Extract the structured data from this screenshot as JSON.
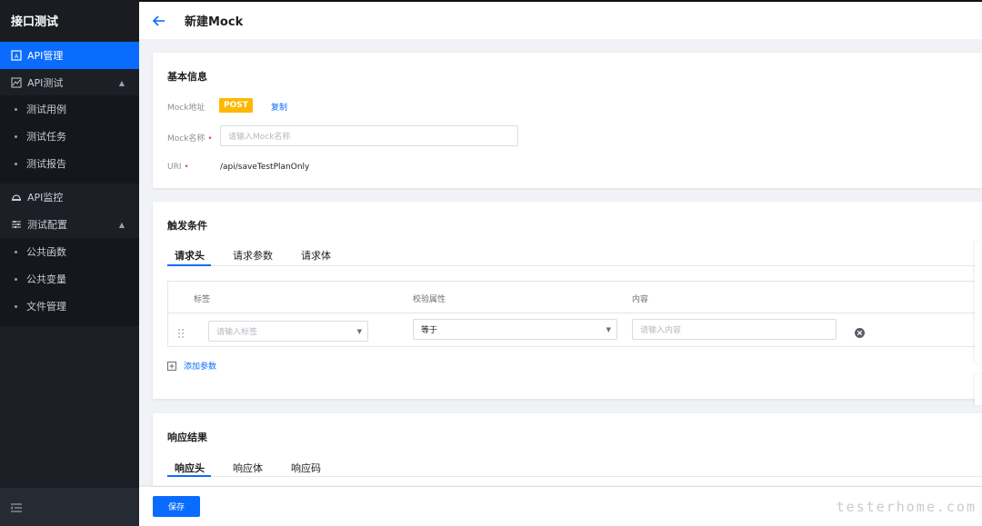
{
  "sidebar": {
    "title": "接口测试",
    "items": [
      {
        "label": "API管理",
        "icon": "api-icon",
        "active": true
      },
      {
        "label": "API测试",
        "icon": "chart-icon"
      },
      {
        "label": "测试用例"
      },
      {
        "label": "测试任务"
      },
      {
        "label": "测试报告"
      },
      {
        "label": "API监控",
        "icon": "monitor-icon"
      },
      {
        "label": "测试配置",
        "icon": "sliders-icon"
      },
      {
        "label": "公共函数"
      },
      {
        "label": "公共变量"
      },
      {
        "label": "文件管理"
      }
    ]
  },
  "header": {
    "title": "新建Mock"
  },
  "basic": {
    "title": "基本信息",
    "mock_address_label": "Mock地址",
    "method": "POST",
    "copy_label": "复制",
    "mock_name_label": "Mock名称",
    "mock_name_placeholder": "请输入Mock名称",
    "uri_label": "URI",
    "uri_value": "/api/saveTestPlanOnly"
  },
  "trigger": {
    "title": "触发条件",
    "tabs": [
      "请求头",
      "请求参数",
      "请求体"
    ],
    "columns": [
      "标签",
      "校验属性",
      "内容"
    ],
    "row": {
      "tag_placeholder": "请输入标签",
      "attr_value": "等于",
      "content_placeholder": "请输入内容"
    },
    "add_param_label": "添加参数"
  },
  "response": {
    "title": "响应结果",
    "tabs": [
      "响应头",
      "响应体",
      "响应码"
    ]
  },
  "footer": {
    "save_label": "保存"
  },
  "watermark": "testerhome.com",
  "colors": {
    "accent": "#0a6cff",
    "post": "#ffb800",
    "sidebar_bg": "#1c1f26"
  }
}
